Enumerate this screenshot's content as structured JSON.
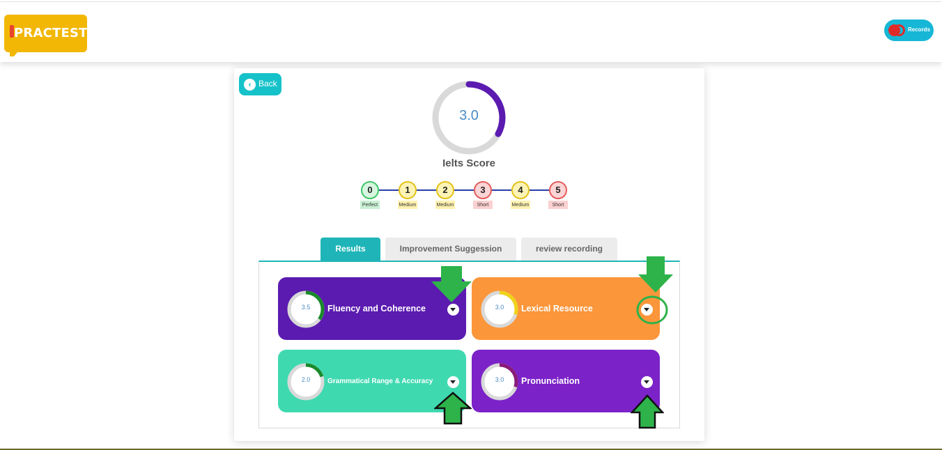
{
  "header": {
    "logo_text": "PRACTEST",
    "records_label": "Records"
  },
  "back_label": "Back",
  "score": {
    "value": "3.0",
    "value_fraction": 0.33,
    "title": "Ielts Score"
  },
  "levels": [
    {
      "num": "0",
      "tag": "Perfect",
      "color": "#3ec768",
      "bg": "#c8f0d4",
      "fill": "#d8f5e0"
    },
    {
      "num": "1",
      "tag": "Medium",
      "color": "#e3c21a",
      "bg": "#fff1b0",
      "fill": "#fdf3b5"
    },
    {
      "num": "2",
      "tag": "Medium",
      "color": "#e3c21a",
      "bg": "#fff1b0",
      "fill": "#fdf3b5"
    },
    {
      "num": "3",
      "tag": "Short",
      "color": "#e55c5c",
      "bg": "#fbd0d0",
      "fill": "#fbd5d5"
    },
    {
      "num": "4",
      "tag": "Medium",
      "color": "#e3c21a",
      "bg": "#fff1b0",
      "fill": "#fdf3b5"
    },
    {
      "num": "5",
      "tag": "Short",
      "color": "#e55c5c",
      "bg": "#fbd0d0",
      "fill": "#fbd5d5"
    }
  ],
  "tabs": {
    "results": "Results",
    "improvement": "Improvement Suggession",
    "review": "review recording"
  },
  "criteria": [
    {
      "label": "Fluency and Coherence",
      "score": "3.5",
      "fraction": 0.35,
      "bg": "#5b1bb0",
      "ring": "#1a8a2a"
    },
    {
      "label": "Lexical Resource",
      "score": "3.0",
      "fraction": 0.3,
      "bg": "#fb963a",
      "ring": "#f0d21a"
    },
    {
      "label": "Grammatical Range & Accuracy",
      "score": "2.0",
      "fraction": 0.2,
      "bg": "#3fd9b0",
      "ring": "#1a8a2a"
    },
    {
      "label": "Pronunciation",
      "score": "3.0",
      "fraction": 0.3,
      "bg": "#7b22c8",
      "ring": "#8a1a7a"
    }
  ],
  "colors": {
    "accent": "#1fb5b8",
    "score_arc": "#5b1bb0",
    "annotation_arrow": "#2db34a"
  }
}
